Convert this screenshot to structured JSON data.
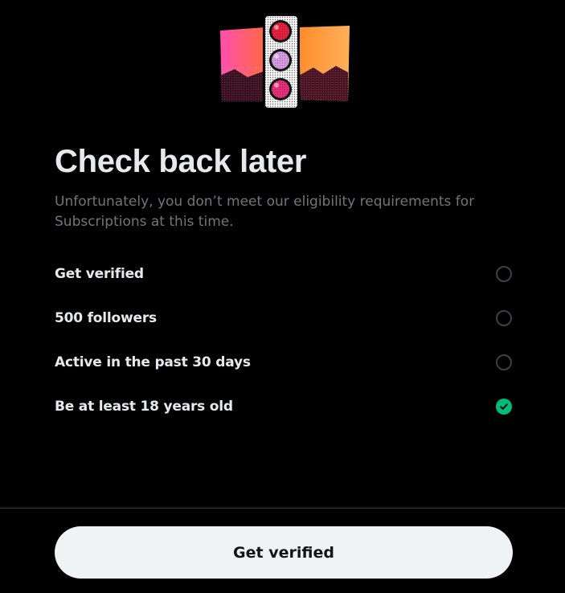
{
  "hero": {
    "icon": "traffic-light-illustration",
    "colors": {
      "left_panel": "#ff4f9a",
      "right_panel": "#ff9933",
      "red_light": "#e8213f",
      "lilac_light": "#d59adf",
      "pink_light": "#e8307a"
    }
  },
  "title": "Check back later",
  "subtitle": "Unfortunately, you don’t meet our eligibility requirements for Subscriptions at this time.",
  "requirements": [
    {
      "label": "Get verified",
      "met": false
    },
    {
      "label": "500 followers",
      "met": false
    },
    {
      "label": "Active in the past 30 days",
      "met": false
    },
    {
      "label": "Be at least 18 years old",
      "met": true
    }
  ],
  "cta": {
    "label": "Get verified"
  },
  "colors": {
    "background": "#000000",
    "text_primary": "#e7e9ea",
    "text_secondary": "#71767b",
    "success": "#00ba7c",
    "button_bg": "#eff3f4",
    "button_text": "#0f1419"
  }
}
